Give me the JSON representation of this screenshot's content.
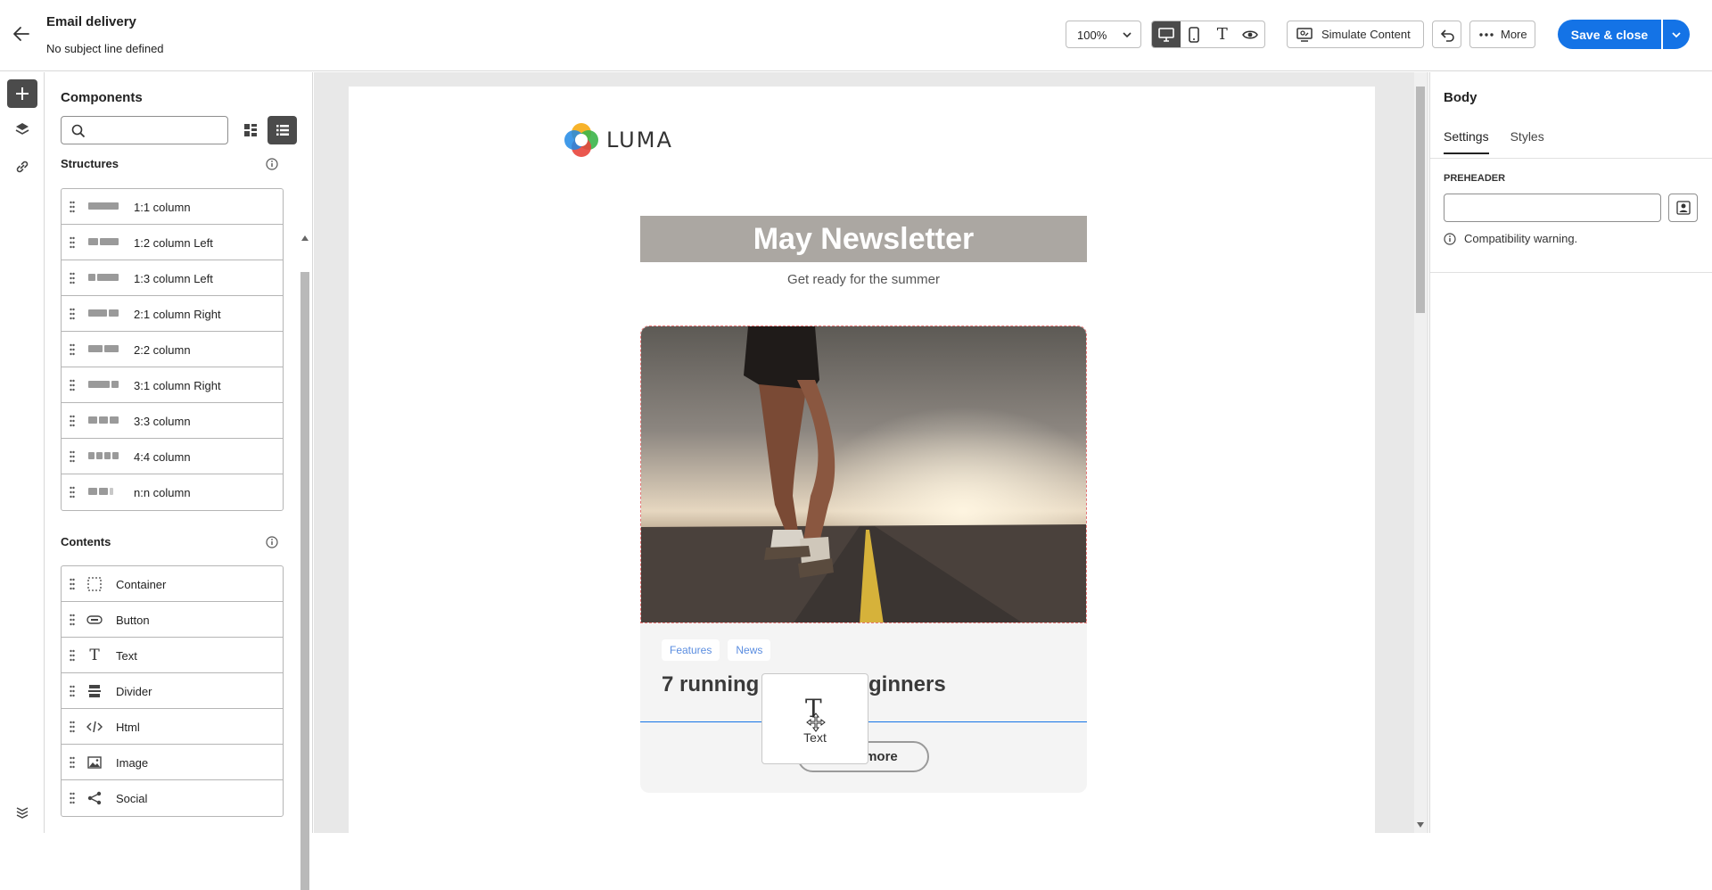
{
  "header": {
    "title": "Email delivery",
    "subtitle": "No subject line defined",
    "zoom": "100%",
    "simulate_label": "Simulate Content",
    "more_label": "More",
    "save_label": "Save & close"
  },
  "components": {
    "title": "Components",
    "search_placeholder": "",
    "structures_title": "Structures",
    "structures": [
      "1:1 column",
      "1:2 column Left",
      "1:3 column Left",
      "2:1 column Right",
      "2:2 column",
      "3:1 column Right",
      "3:3 column",
      "4:4 column",
      "n:n column"
    ],
    "contents_title": "Contents",
    "contents": [
      "Container",
      "Button",
      "Text",
      "Divider",
      "Html",
      "Image",
      "Social"
    ]
  },
  "email": {
    "logo_text": "LUMA",
    "banner": "May Newsletter",
    "subtitle": "Get ready for the summer",
    "tags": [
      "Features",
      "News"
    ],
    "card_title": "7 running tips for beginners",
    "read_more": "Read more",
    "drag_label": "Text"
  },
  "right_panel": {
    "title": "Body",
    "tabs": [
      "Settings",
      "Styles"
    ],
    "preheader_label": "PREHEADER",
    "preheader_value": "",
    "warning": "Compatibility warning."
  },
  "colors": {
    "accent": "#1473e6",
    "banner_bg": "#aba7a2",
    "tag_text": "#5a8de0",
    "active_dark": "#4b4b4b"
  }
}
